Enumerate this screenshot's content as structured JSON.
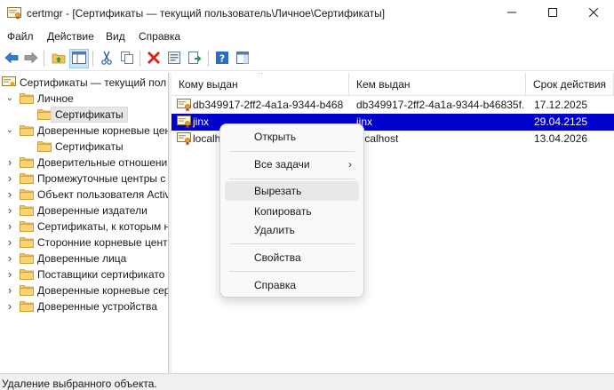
{
  "window": {
    "title": "certmgr - [Сертификаты — текущий пользователь\\Личное\\Сертификаты]",
    "icons": [
      "certmgr-app-icon",
      "minimize-icon",
      "maximize-icon",
      "close-icon"
    ]
  },
  "menubar": {
    "items": [
      {
        "label": "Файл"
      },
      {
        "label": "Действие"
      },
      {
        "label": "Вид"
      },
      {
        "label": "Справка"
      }
    ]
  },
  "toolbar": {
    "buttons": [
      "back-icon",
      "forward-icon",
      "up-folder-icon",
      "show-hide-tree-icon",
      "cut-icon",
      "copy-icon",
      "delete-icon",
      "properties-icon",
      "export-list-icon",
      "help-icon",
      "console-pane-icon"
    ]
  },
  "tree": {
    "items": [
      {
        "label": "Сертификаты — текущий пол",
        "level": 0,
        "expanded": true,
        "icon": "certificate-store-icon"
      },
      {
        "label": "Личное",
        "level": 1,
        "expanded": true,
        "icon": "folder-icon"
      },
      {
        "label": "Сертификаты",
        "level": 2,
        "selected": true,
        "icon": "folder-open-icon"
      },
      {
        "label": "Доверенные корневые цен",
        "level": 1,
        "expanded": true,
        "icon": "folder-icon"
      },
      {
        "label": "Сертификаты",
        "level": 2,
        "icon": "folder-icon"
      },
      {
        "label": "Доверительные отношени",
        "level": 1,
        "icon": "folder-icon"
      },
      {
        "label": "Промежуточные центры с",
        "level": 1,
        "icon": "folder-icon"
      },
      {
        "label": "Объект пользователя Activ",
        "level": 1,
        "icon": "folder-icon"
      },
      {
        "label": "Доверенные издатели",
        "level": 1,
        "icon": "folder-icon"
      },
      {
        "label": "Сертификаты, к которым н",
        "level": 1,
        "icon": "folder-icon"
      },
      {
        "label": "Сторонние корневые цент",
        "level": 1,
        "icon": "folder-icon"
      },
      {
        "label": "Доверенные лица",
        "level": 1,
        "icon": "folder-icon"
      },
      {
        "label": "Поставщики сертификато",
        "level": 1,
        "icon": "folder-icon"
      },
      {
        "label": "Доверенные корневые сер",
        "level": 1,
        "icon": "folder-icon"
      },
      {
        "label": "Доверенные устройства",
        "level": 1,
        "icon": "folder-icon"
      }
    ]
  },
  "list": {
    "columns": [
      "Кому выдан",
      "Кем выдан",
      "Срок действия"
    ],
    "rows": [
      {
        "issued_to": "db349917-2ff2-4a1a-9344-b468...",
        "issued_by": "db349917-2ff2-4a1a-9344-b46835f...",
        "expires": "17.12.2025"
      },
      {
        "issued_to": "jinx",
        "issued_by": "jinx",
        "expires": "29.04.2125",
        "selected": true
      },
      {
        "issued_to": "localh",
        "issued_by": "localhost",
        "expires": "13.04.2026"
      }
    ]
  },
  "context_menu": {
    "items": [
      {
        "label": "Открыть"
      },
      {
        "label": "Все задачи",
        "submenu": true
      },
      {
        "label": "Вырезать",
        "hover": true
      },
      {
        "label": "Копировать"
      },
      {
        "label": "Удалить"
      },
      {
        "label": "Свойства"
      },
      {
        "label": "Справка"
      }
    ]
  },
  "status": {
    "text": "Удаление выбранного объекта."
  },
  "colors": {
    "selection": "#0000cc",
    "folder": "#f0c45a",
    "accent_blue": "#2b6cc4",
    "delete_red": "#d9261c"
  }
}
